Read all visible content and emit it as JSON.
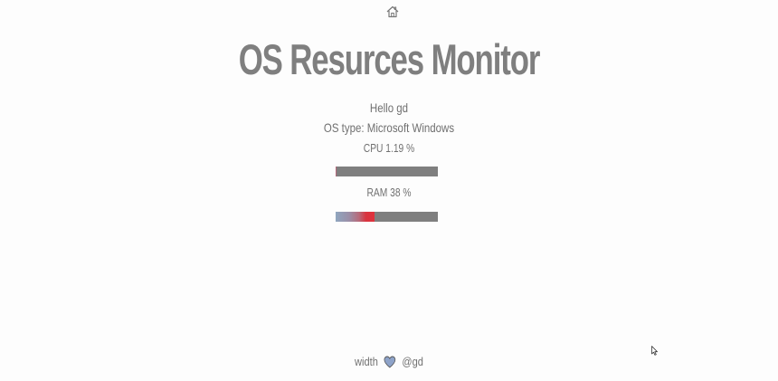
{
  "header": {
    "home_icon": "home-icon",
    "title": "OS Resurces Monitor"
  },
  "info": {
    "greeting": "Hello gd",
    "os_type": "OS type: Microsoft Windows"
  },
  "cpu": {
    "label": "CPU 1.19 %",
    "percent": 1.19
  },
  "ram": {
    "label": "RAM 38 %",
    "percent": 38
  },
  "footer": {
    "prefix": "width",
    "icon": "heart-icon",
    "author": "@gd"
  },
  "colors": {
    "bar_track": "#7f7f7f",
    "bar_fill_start": "#8fa6bf",
    "bar_fill_end": "#e0313c",
    "heart": "#8ea3c9",
    "text": "#707070"
  }
}
